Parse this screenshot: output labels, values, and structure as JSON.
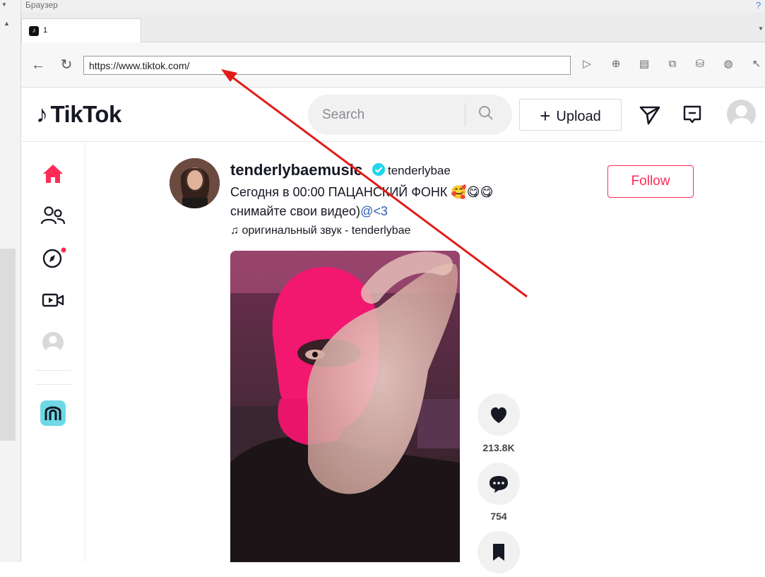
{
  "browser": {
    "window_title": "Браузер",
    "help_glyph": "?",
    "tab_label": "1",
    "url": "https://www.tiktok.com/"
  },
  "tiktok": {
    "logo_text": "TikTok",
    "search_placeholder": "Search",
    "upload_label": "Upload",
    "post": {
      "username": "tenderlybaemusic",
      "nickname": "tenderlybae",
      "caption_line1": "Сегодня в 00:00 ПАЦАНСКИЙ ФОНК 🥰😋😋",
      "caption_line2_text": "снимайте свои видео)",
      "caption_line2_tag": "@<3",
      "sound": "оригинальный звук - tenderlybae",
      "follow_label": "Follow",
      "likes": "213.8K",
      "comments": "754"
    }
  },
  "colors": {
    "brand_red": "#fe2c55",
    "annotation_arrow": "#e31b1b",
    "text_primary": "#161823",
    "verified_blue": "#20d5ec"
  },
  "icons": [
    "home-icon",
    "following-icon",
    "explore-icon",
    "live-icon",
    "profile-icon",
    "creator-icon",
    "send-icon",
    "inbox-icon",
    "heart-icon",
    "comment-icon",
    "bookmark-icon",
    "music-note-icon",
    "search-icon"
  ]
}
